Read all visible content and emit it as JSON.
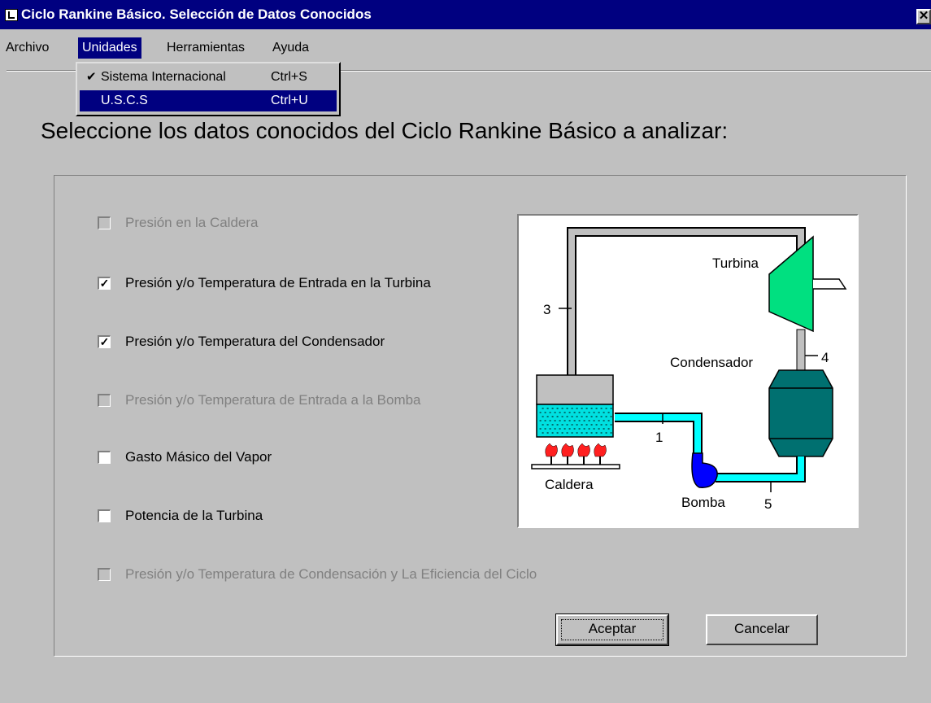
{
  "window": {
    "title": "Ciclo Rankine Básico.  Selección de Datos Conocidos",
    "close_glyph": "✕"
  },
  "menu": {
    "archivo": "Archivo",
    "unidades": "Unidades",
    "herramientas": "Herramientas",
    "ayuda": "Ayuda"
  },
  "units_menu": {
    "items": [
      {
        "check": "✔",
        "label": "Sistema Internacional",
        "shortcut": "Ctrl+S"
      },
      {
        "check": "",
        "label": "U.S.C.S",
        "shortcut": "Ctrl+U"
      }
    ]
  },
  "headline": "Seleccione los datos conocidos del Ciclo Rankine Básico a analizar:",
  "options": [
    {
      "label": "Presión en la Caldera",
      "checked": false,
      "enabled": false
    },
    {
      "label": "Presión y/o Temperatura de Entrada en la Turbina",
      "checked": true,
      "enabled": true
    },
    {
      "label": "Presión y/o Temperatura del Condensador",
      "checked": true,
      "enabled": true
    },
    {
      "label": "Presión y/o Temperatura de Entrada a la Bomba",
      "checked": false,
      "enabled": false
    },
    {
      "label": "Gasto Másico del Vapor",
      "checked": false,
      "enabled": true
    },
    {
      "label": "Potencia de la Turbina",
      "checked": false,
      "enabled": true
    },
    {
      "label": "Presión y/o Temperatura de Condensación y La Eficiencia del Ciclo",
      "checked": false,
      "enabled": false
    }
  ],
  "diagram": {
    "turbina": "Turbina",
    "condensador": "Condensador",
    "caldera": "Caldera",
    "bomba": "Bomba",
    "state_1": "1",
    "state_3": "3",
    "state_4": "4",
    "state_5": "5",
    "colors": {
      "turbine": "#00e080",
      "condenser": "#007070",
      "water": "#00ffff",
      "pump": "#0000ff",
      "flame": "#ff2020",
      "steam_pipe": "#c0c0c0"
    }
  },
  "buttons": {
    "accept": "Aceptar",
    "cancel": "Cancelar"
  }
}
